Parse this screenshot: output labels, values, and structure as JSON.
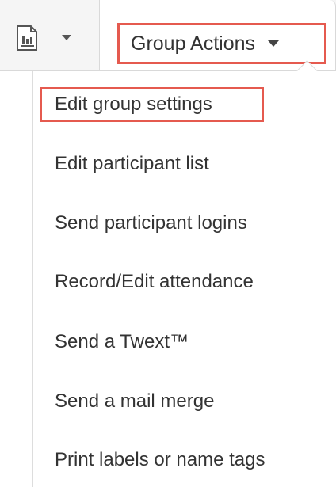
{
  "toolbar": {
    "report_icon": "report-chart-icon",
    "report_caret_icon": "caret-down-icon",
    "group_actions_label": "Group Actions",
    "group_actions_caret_icon": "caret-down-icon",
    "highlight_color": "#e55a4f"
  },
  "menu": {
    "items": [
      {
        "label": "Edit group settings",
        "highlighted": true
      },
      {
        "label": "Edit participant list"
      },
      {
        "label": "Send participant logins"
      },
      {
        "label": "Record/Edit attendance"
      },
      {
        "label": "Send a Twext™"
      },
      {
        "label": "Send a mail merge"
      },
      {
        "label": "Print labels or name tags"
      }
    ]
  }
}
